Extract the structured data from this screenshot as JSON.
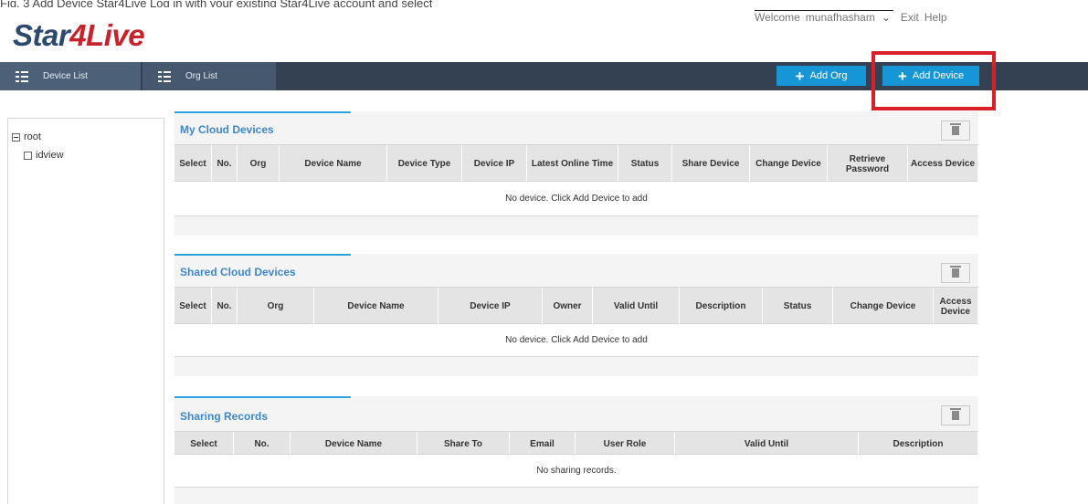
{
  "top_cut_text": "Fig. 3 Add Device Star4Live Log in with your existing Star4Live account and select",
  "logo": {
    "part1": "Star",
    "part2": "4Live"
  },
  "userbar": {
    "welcome": "Welcome",
    "username": "munafhasham",
    "exit": "Exit",
    "help": "Help"
  },
  "nav": {
    "device_list": "Device List",
    "org_list": "Org List"
  },
  "buttons": {
    "add_org": "Add Org",
    "add_device": "Add Device"
  },
  "tree": {
    "root": "root",
    "child": "idview"
  },
  "my_cloud": {
    "title": "My Cloud Devices",
    "columns": [
      "Select",
      "No.",
      "Org",
      "Device Name",
      "Device Type",
      "Device IP",
      "Latest Online Time",
      "Status",
      "Share Device",
      "Change Device",
      "Retrieve Password",
      "Access Device"
    ],
    "empty": "No device. Click Add Device to add"
  },
  "shared_cloud": {
    "title": "Shared Cloud Devices",
    "columns": [
      "Select",
      "No.",
      "Org",
      "Device Name",
      "Device IP",
      "Owner",
      "Valid Until",
      "Description",
      "Status",
      "Change Device",
      "Access Device"
    ],
    "empty": "No device. Click Add Device to add"
  },
  "sharing_records": {
    "title": "Sharing Records",
    "columns": [
      "Select",
      "No.",
      "Device Name",
      "Share To",
      "Email",
      "User Role",
      "Valid Until",
      "Description"
    ],
    "empty": "No sharing records."
  },
  "colors": {
    "navbar": "#344152",
    "button": "#1696d6",
    "highlight": "#d92028",
    "title": "#3f87c9",
    "logo_red": "#c8232c"
  }
}
